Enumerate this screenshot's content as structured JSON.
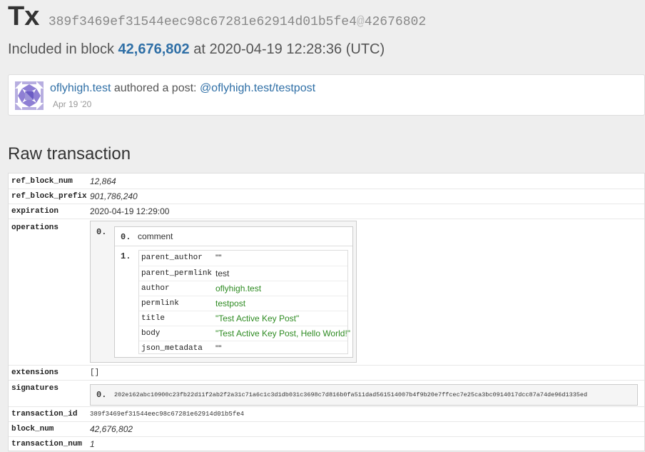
{
  "header": {
    "title": "Tx",
    "hash": "389f3469ef31544eec98c67281e62914d01b5fe4",
    "at": "@",
    "block_ref": "42676802"
  },
  "included": {
    "prefix": "Included in block",
    "block": "42,676,802",
    "middle": "at",
    "datetime": "2020-04-19 12:28:36 (UTC)"
  },
  "post": {
    "author": "oflyhigh.test",
    "action": "authored a post:",
    "link": "@oflyhigh.test/testpost",
    "date": "Apr 19 '20"
  },
  "raw": {
    "title": "Raw transaction",
    "ref_block_num": {
      "key": "ref_block_num",
      "value": "12,864"
    },
    "ref_block_prefix": {
      "key": "ref_block_prefix",
      "value": "901,786,240"
    },
    "expiration": {
      "key": "expiration",
      "value": "2020-04-19 12:29:00"
    },
    "operations": {
      "key": "operations",
      "index": "0.",
      "type_index": "0.",
      "type": "comment",
      "params_index": "1.",
      "params": [
        {
          "key": "parent_author",
          "value": "\"\""
        },
        {
          "key": "parent_permlink",
          "value": "test"
        },
        {
          "key": "author",
          "value": "oflyhigh.test"
        },
        {
          "key": "permlink",
          "value": "testpost"
        },
        {
          "key": "title",
          "value": "\"Test Active Key Post\""
        },
        {
          "key": "body",
          "value": "\"Test Active Key Post, Hello World!\""
        },
        {
          "key": "json_metadata",
          "value": "\"\""
        }
      ]
    },
    "extensions": {
      "key": "extensions",
      "value": "[]"
    },
    "signatures": {
      "key": "signatures",
      "index": "0.",
      "value": "202e162abc10900c23fb22d11f2ab2f2a31c71a6c1c3d1db031c3698c7d816b0fa511dad561514007b4f9b20e7ffcec7e25ca3bc0914017dcc87a74de96d1335ed"
    },
    "transaction_id": {
      "key": "transaction_id",
      "value": "389f3469ef31544eec98c67281e62914d01b5fe4"
    },
    "block_num": {
      "key": "block_num",
      "value": "42,676,802"
    },
    "transaction_num": {
      "key": "transaction_num",
      "value": "1"
    }
  }
}
